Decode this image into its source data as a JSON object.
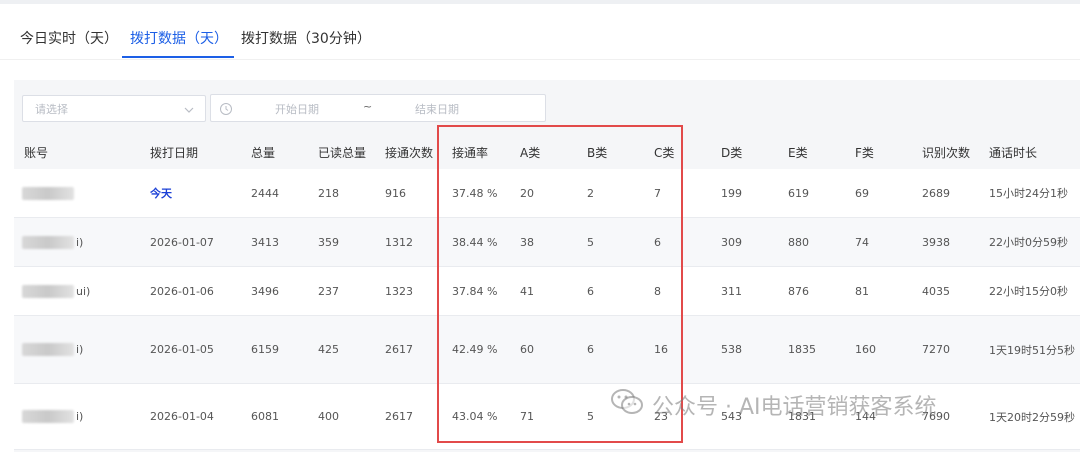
{
  "tabs": [
    {
      "label": "今日实时（天）",
      "active": false
    },
    {
      "label": "拨打数据（天）",
      "active": true
    },
    {
      "label": "拨打数据（30分钟）",
      "active": false
    }
  ],
  "filters": {
    "select_placeholder": "请选择",
    "start_date_placeholder": "开始日期",
    "separator": "~",
    "end_date_placeholder": "结束日期"
  },
  "table": {
    "columns": [
      "账号",
      "拨打日期",
      "总量",
      "已读总量",
      "接通次数",
      "接通率",
      "A类",
      "B类",
      "C类",
      "D类",
      "E类",
      "F类",
      "识别次数",
      "通话时长"
    ],
    "rows": [
      {
        "account_suffix": "",
        "cells": [
          "今天",
          "2444",
          "218",
          "916",
          "37.48 %",
          "20",
          "2",
          "7",
          "199",
          "619",
          "69",
          "2689",
          "15小时24分1秒"
        ]
      },
      {
        "account_suffix": "i)",
        "cells": [
          "2026-01-07",
          "3413",
          "359",
          "1312",
          "38.44 %",
          "38",
          "5",
          "6",
          "309",
          "880",
          "74",
          "3938",
          "22小时0分59秒"
        ]
      },
      {
        "account_suffix": "ui)",
        "cells": [
          "2026-01-06",
          "3496",
          "237",
          "1323",
          "37.84 %",
          "41",
          "6",
          "8",
          "311",
          "876",
          "81",
          "4035",
          "22小时15分0秒"
        ]
      },
      {
        "account_suffix": "i)",
        "cells": [
          "2026-01-05",
          "6159",
          "425",
          "2617",
          "42.49 %",
          "60",
          "6",
          "16",
          "538",
          "1835",
          "160",
          "7270",
          "1天19时51分5秒"
        ]
      },
      {
        "account_suffix": "i)",
        "cells": [
          "2026-01-04",
          "6081",
          "400",
          "2617",
          "43.04 %",
          "71",
          "5",
          "23",
          "543",
          "1831",
          "144",
          "7690",
          "1天20时2分59秒"
        ]
      }
    ]
  },
  "watermark": {
    "text": "公众号 · AI电话营销获客系统",
    "icon": "wechat-icon"
  },
  "colors": {
    "accent": "#1c5fe6",
    "highlight": "#e24a4a",
    "today": "#1a3fd6"
  }
}
